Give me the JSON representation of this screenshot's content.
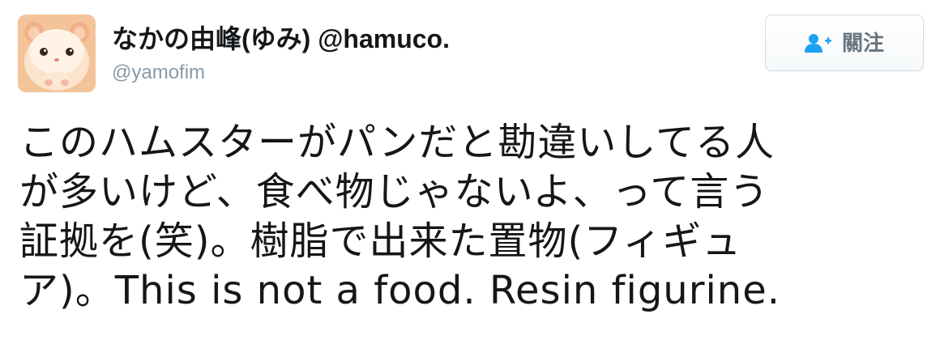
{
  "user": {
    "display_name": "なかの由峰(ゆみ) @hamuco.",
    "screen_name": "@yamofim",
    "avatar_icon": "hamster-avatar-icon"
  },
  "follow": {
    "label": "關注",
    "icon": "add-user-icon"
  },
  "tweet": {
    "lines": [
      "このハムスターがパンだと勘違いしてる人",
      "が多いけど、食べ物じゃないよ、って言う",
      "証拠を(笑)。樹脂で出来た置物(フィギュ",
      "ア)。This is not a food. Resin figurine."
    ]
  },
  "colors": {
    "text": "#14171a",
    "secondary": "#8899a6",
    "accent": "#1da1f2",
    "button_text": "#66757f",
    "button_border": "#d4dbe1"
  }
}
